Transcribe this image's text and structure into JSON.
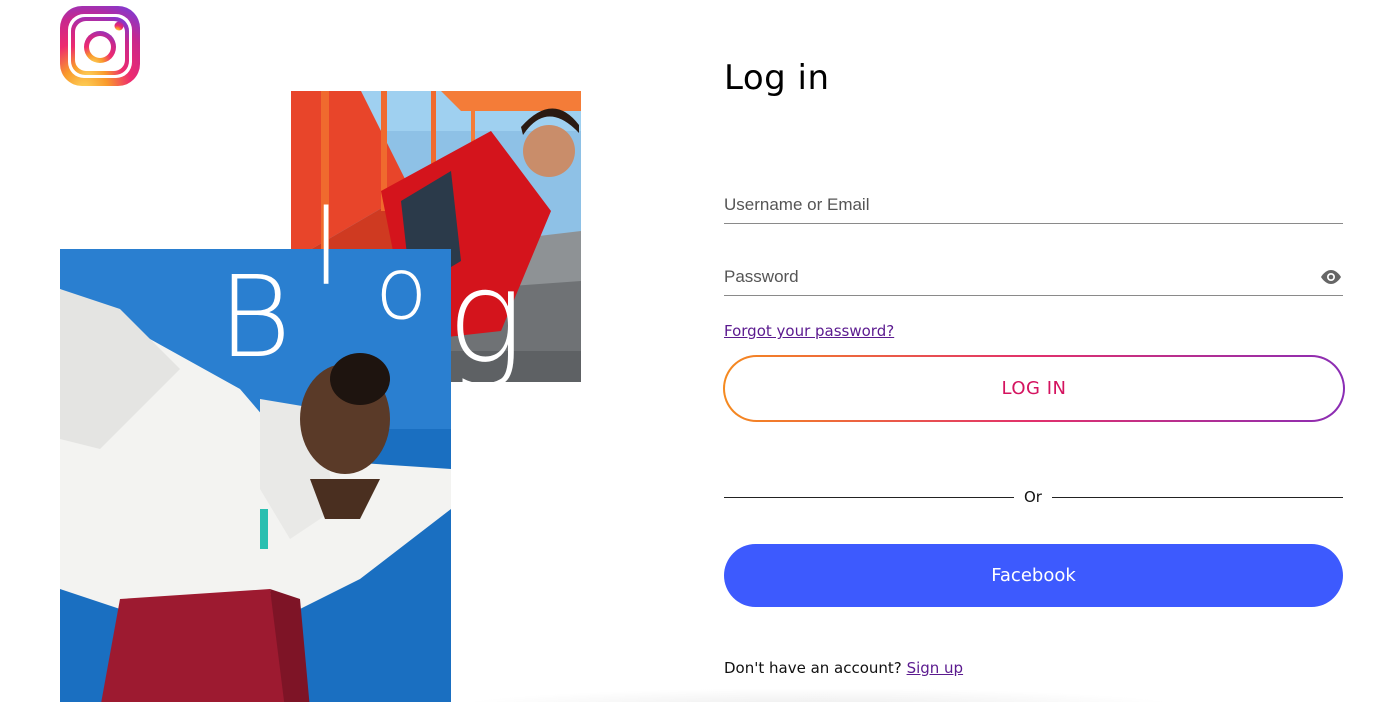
{
  "brand": {
    "logo_icon": "instagram-logo-icon",
    "gradient_colors": [
      "#f58a1f",
      "#e1306c",
      "#8a2db5"
    ]
  },
  "hero": {
    "wordmark_letters": [
      "B",
      "l",
      "o",
      "g"
    ]
  },
  "login_form": {
    "title": "Log in",
    "username_placeholder": "Username or Email",
    "password_placeholder": "Password",
    "show_password_icon": "eye-icon",
    "forgot_password": "Forgot your password?",
    "login_button": "LOG IN",
    "divider_text": "Or",
    "facebook_button": "Facebook",
    "signup_prompt": "Don't have an account?",
    "signup_link": "Sign up"
  },
  "colors": {
    "facebook_blue": "#3d5afe",
    "link_purple": "#5b1a8f",
    "login_text": "#d4135f"
  }
}
